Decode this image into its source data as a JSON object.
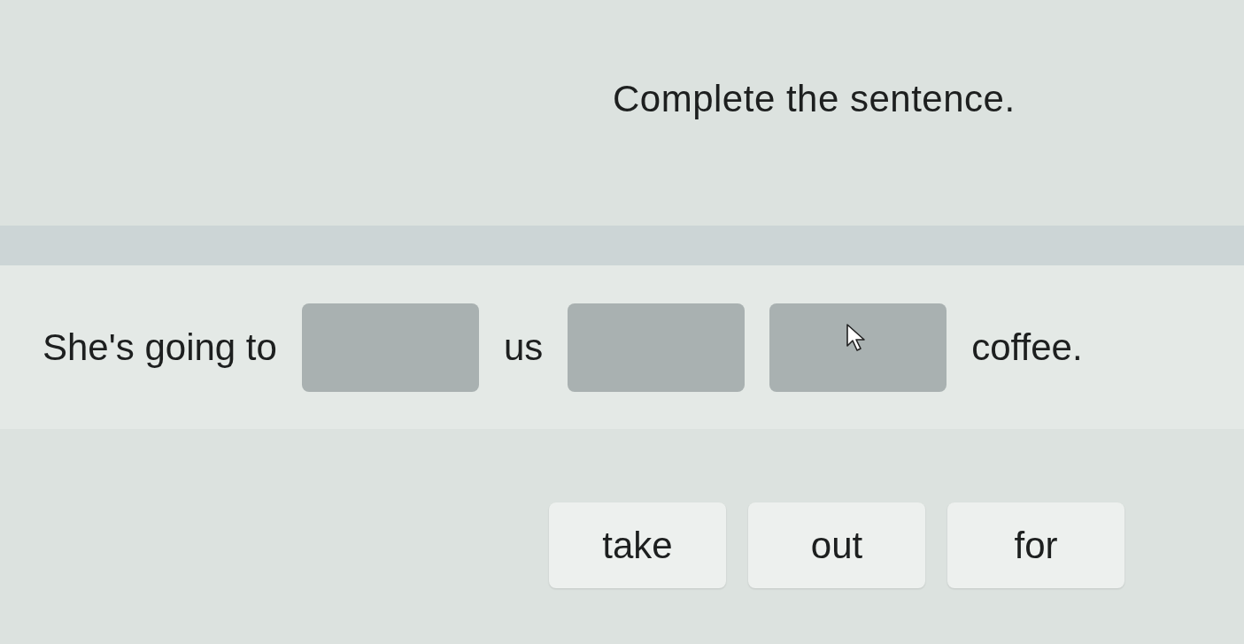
{
  "instruction": "Complete the sentence.",
  "sentence": [
    {
      "kind": "text",
      "text": "She's going to"
    },
    {
      "kind": "blank"
    },
    {
      "kind": "text",
      "text": "us"
    },
    {
      "kind": "blank"
    },
    {
      "kind": "blank",
      "pointer": true
    },
    {
      "kind": "text",
      "text": "coffee."
    }
  ],
  "options": [
    "take",
    "out",
    "for"
  ]
}
